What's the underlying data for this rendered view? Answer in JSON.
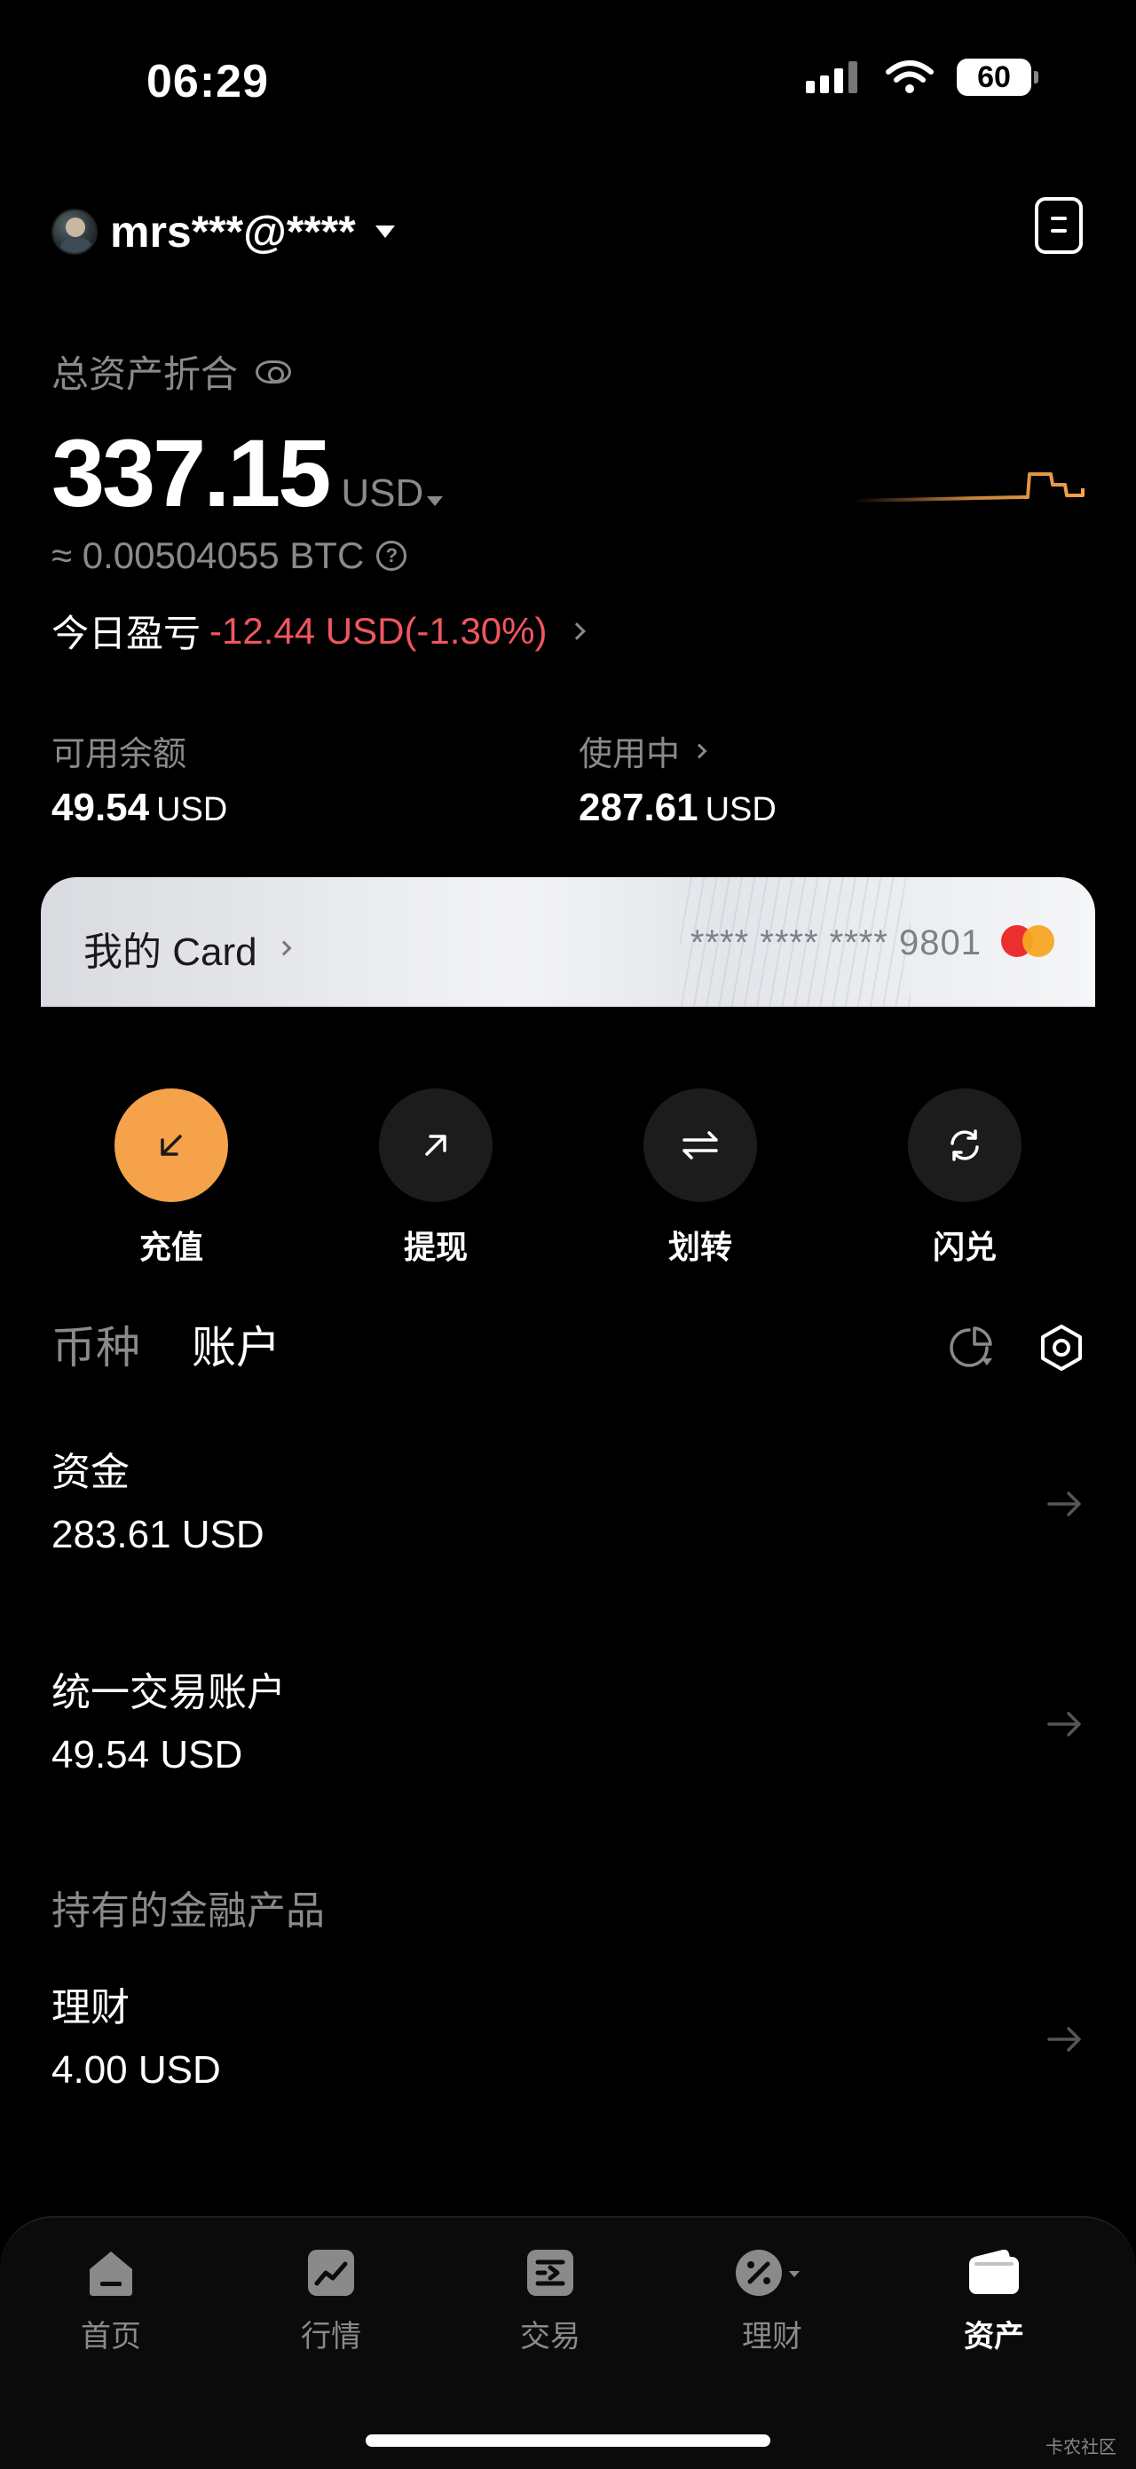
{
  "status_bar": {
    "time": "06:29",
    "battery": "60"
  },
  "header": {
    "account_name": "mrs***@****"
  },
  "summary": {
    "total_label": "总资产折合",
    "total_value": "337.15",
    "total_unit": "USD",
    "btc_equiv": "≈ 0.00504055 BTC",
    "pnl_label": "今日盈亏",
    "pnl_value": "-12.44 USD(-1.30%)",
    "available_label": "可用余额",
    "available_value": "49.54",
    "available_unit": "USD",
    "in_use_label": "使用中",
    "in_use_value": "287.61",
    "in_use_unit": "USD",
    "pnl_color": "#f0565f"
  },
  "card": {
    "title": "我的 Card",
    "number": "**** **** **** 9801"
  },
  "actions": [
    {
      "label": "充值",
      "icon": "arrow-down-left-icon"
    },
    {
      "label": "提现",
      "icon": "arrow-up-right-icon"
    },
    {
      "label": "划转",
      "icon": "transfer-icon"
    },
    {
      "label": "闪兑",
      "icon": "refresh-icon"
    }
  ],
  "tabs": [
    {
      "label": "币种"
    },
    {
      "label": "账户"
    }
  ],
  "accounts": [
    {
      "title": "资金",
      "value": "283.61 USD"
    },
    {
      "title": "统一交易账户",
      "value": "49.54 USD"
    }
  ],
  "products_section": {
    "label": "持有的金融产品"
  },
  "products": [
    {
      "title": "理财",
      "value": "4.00 USD"
    }
  ],
  "nav": [
    {
      "label": "首页",
      "icon": "home-icon"
    },
    {
      "label": "行情",
      "icon": "chart-icon"
    },
    {
      "label": "交易",
      "icon": "trade-icon"
    },
    {
      "label": "理财",
      "icon": "percent-icon"
    },
    {
      "label": "资产",
      "icon": "wallet-icon"
    }
  ],
  "watermark": "卡农社区",
  "colors": {
    "accent": "#f5a24b",
    "background": "#000000",
    "muted": "#8a8a8a"
  }
}
